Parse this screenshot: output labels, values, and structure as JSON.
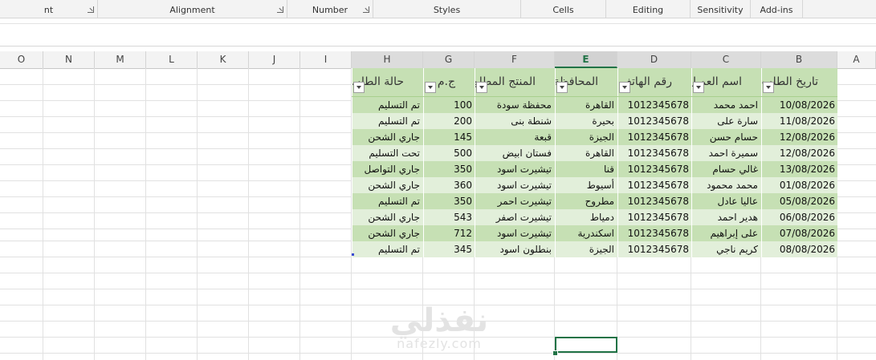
{
  "ribbon": {
    "groups": [
      {
        "label": "nt",
        "launcher": true
      },
      {
        "label": "Alignment",
        "launcher": true
      },
      {
        "label": "Number",
        "launcher": true
      },
      {
        "label": "Styles",
        "launcher": false
      },
      {
        "label": "Cells",
        "launcher": false
      },
      {
        "label": "Editing",
        "launcher": false
      },
      {
        "label": "Sensitivity",
        "launcher": false
      },
      {
        "label": "Add-ins",
        "launcher": false
      }
    ]
  },
  "columns": [
    "O",
    "N",
    "M",
    "L",
    "K",
    "J",
    "I",
    "H",
    "G",
    "F",
    "E",
    "D",
    "C",
    "B",
    "A"
  ],
  "selected_column": "E",
  "table": {
    "headers": {
      "order_date": "تاريخ الطلب",
      "customer": "اسم العميل",
      "phone": "رقم الهاتف",
      "governorate": "المحافظة",
      "product": "المنتج المطلوب",
      "price": "ج.م",
      "status": "حالة الطلب"
    },
    "rows": [
      {
        "order_date": "10/08/2026",
        "customer": "احمد محمد",
        "phone": "1012345678",
        "governorate": "القاهرة",
        "product": "محفظة سودة",
        "price": "100",
        "status": "تم التسليم"
      },
      {
        "order_date": "11/08/2026",
        "customer": "سارة على",
        "phone": "1012345678",
        "governorate": "بحيرة",
        "product": "شنطة بنى",
        "price": "200",
        "status": "تم التسليم"
      },
      {
        "order_date": "12/08/2026",
        "customer": "حسام حسن",
        "phone": "1012345678",
        "governorate": "الجيزة",
        "product": "قبعة",
        "price": "145",
        "status": "جاري الشحن"
      },
      {
        "order_date": "12/08/2026",
        "customer": "سميرة احمد",
        "phone": "1012345678",
        "governorate": "القاهرة",
        "product": "فستان ابيض",
        "price": "500",
        "status": "تحت التسليم"
      },
      {
        "order_date": "13/08/2026",
        "customer": "غالي حسام",
        "phone": "1012345678",
        "governorate": "قنا",
        "product": "تيشيرت اسود",
        "price": "350",
        "status": "جاري التواصل"
      },
      {
        "order_date": "01/08/2026",
        "customer": "محمد محمود",
        "phone": "1012345678",
        "governorate": "أسيوط",
        "product": "تيشيرت اسود",
        "price": "360",
        "status": "جاري الشحن"
      },
      {
        "order_date": "05/08/2026",
        "customer": "عاليا عادل",
        "phone": "1012345678",
        "governorate": "مطروح",
        "product": "تيشيرت احمر",
        "price": "350",
        "status": "تم التسليم"
      },
      {
        "order_date": "06/08/2026",
        "customer": "هدير احمد",
        "phone": "1012345678",
        "governorate": "دمياط",
        "product": "تيشيرت اصفر",
        "price": "543",
        "status": "جاري الشحن"
      },
      {
        "order_date": "07/08/2026",
        "customer": "على إبراهيم",
        "phone": "1012345678",
        "governorate": "اسكندرية",
        "product": "تيشيرت اسود",
        "price": "712",
        "status": "جاري الشحن"
      },
      {
        "order_date": "08/08/2026",
        "customer": "كريم ناجي",
        "phone": "1012345678",
        "governorate": "الجيزة",
        "product": "بنطلون اسود",
        "price": "345",
        "status": "تم التسليم"
      }
    ]
  },
  "watermark": {
    "logo": "نفذلي",
    "url": "nafezly.com"
  },
  "colors": {
    "accent": "#217346",
    "table_header": "#c6e0b4",
    "band_dark": "#c6e0b4",
    "band_light": "#e2efda"
  }
}
